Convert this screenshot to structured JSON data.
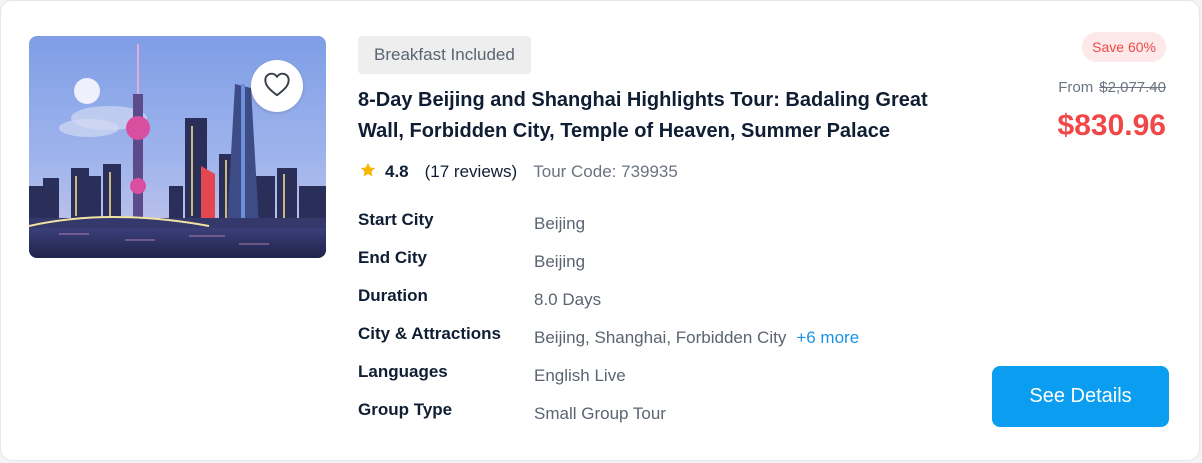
{
  "tour": {
    "tag": "Breakfast Included",
    "title": "8-Day Beijing and Shanghai Highlights Tour: Badaling Great Wall, Forbidden City, Temple of Heaven, Summer Palace",
    "rating": "4.8",
    "reviews": "(17 reviews)",
    "tour_code": "Tour Code: 739935",
    "image_icon": "favorite-heart-icon",
    "rating_icon": "star-icon"
  },
  "details": {
    "start_city": {
      "label": "Start City",
      "value": "Beijing"
    },
    "end_city": {
      "label": "End City",
      "value": "Beijing"
    },
    "duration": {
      "label": "Duration",
      "value": "8.0 Days"
    },
    "attractions": {
      "label": "City & Attractions",
      "value": "Beijing, Shanghai, Forbidden City",
      "more": "+6 more"
    },
    "languages": {
      "label": "Languages",
      "value": "English Live"
    },
    "group_type": {
      "label": "Group Type",
      "value": "Small Group Tour"
    }
  },
  "pricing": {
    "save": "Save 60%",
    "from_label": "From",
    "original_price": "$2,077.40",
    "price": "$830.96",
    "cta": "See Details"
  },
  "colors": {
    "accent_blue": "#0b9ef0",
    "price_red": "#f04848",
    "link_blue": "#1a93e8",
    "star_yellow": "#f7b500"
  }
}
